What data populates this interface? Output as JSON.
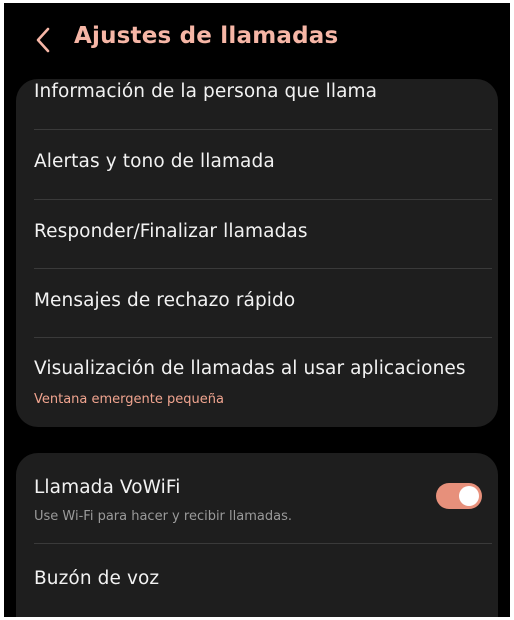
{
  "header": {
    "back_icon": "chevron-left-icon",
    "title": "Ajustes de llamadas"
  },
  "colors": {
    "accent": "#f6b6a6",
    "subtitle_accent": "#f0a48f",
    "toggle_on": "#e7907b",
    "card_bg": "#1e1e1e",
    "background": "#000000"
  },
  "call_settings": {
    "items": [
      {
        "label": "Información de la persona que llama"
      },
      {
        "label": "Alertas y tono de llamada"
      },
      {
        "label": "Responder/Finalizar llamadas"
      },
      {
        "label": "Mensajes de rechazo rápido"
      },
      {
        "label": "Visualización de llamadas al usar aplicaciones",
        "sublabel": "Ventana emergente pequeña"
      }
    ]
  },
  "network_settings": {
    "vowifi": {
      "label": "Llamada VoWiFi",
      "sublabel": "Use Wi-Fi para hacer y recibir llamadas.",
      "enabled": true
    },
    "voicemail": {
      "label": "Buzón de voz"
    }
  }
}
